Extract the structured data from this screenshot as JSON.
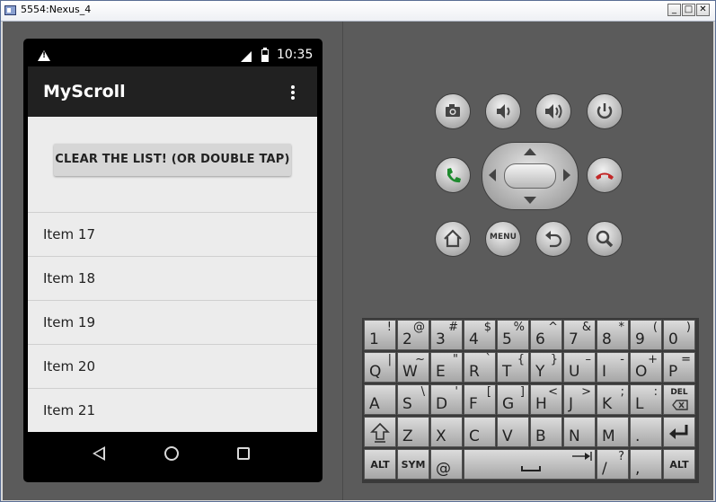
{
  "window": {
    "title": "5554:Nexus_4",
    "min_glyph": "_",
    "max_glyph": "□",
    "close_glyph": "✕"
  },
  "device": {
    "clock": "10:35",
    "app_title": "MyScroll",
    "clear_button": "CLEAR THE LIST! (OR DOUBLE TAP)",
    "list_items": [
      "Item 17",
      "Item 18",
      "Item 19",
      "Item 20",
      "Item 21"
    ]
  },
  "controls": {
    "menu_label": "MENU"
  },
  "keyboard": {
    "row1": [
      [
        "1",
        "!"
      ],
      [
        "2",
        "@"
      ],
      [
        "3",
        "#"
      ],
      [
        "4",
        "$"
      ],
      [
        "5",
        "%"
      ],
      [
        "6",
        "^"
      ],
      [
        "7",
        "&"
      ],
      [
        "8",
        "*"
      ],
      [
        "9",
        "("
      ],
      [
        "0",
        ")"
      ]
    ],
    "row2": [
      [
        "Q",
        "|"
      ],
      [
        "W",
        "~"
      ],
      [
        "E",
        "\""
      ],
      [
        "R",
        "`"
      ],
      [
        "T",
        "{"
      ],
      [
        "Y",
        "}"
      ],
      [
        "U",
        "–"
      ],
      [
        "I",
        "-"
      ],
      [
        "O",
        "+"
      ],
      [
        "P",
        "="
      ]
    ],
    "row3": [
      [
        "A",
        ""
      ],
      [
        "S",
        "\\"
      ],
      [
        "D",
        "'"
      ],
      [
        "F",
        "["
      ],
      [
        "G",
        "]"
      ],
      [
        "H",
        "<"
      ],
      [
        "J",
        ">"
      ],
      [
        "K",
        ";"
      ],
      [
        "L",
        ":"
      ]
    ],
    "row4": [
      [
        "Z",
        ""
      ],
      [
        "X",
        ""
      ],
      [
        "C",
        ""
      ],
      [
        "V",
        ""
      ],
      [
        "B",
        ""
      ],
      [
        "N",
        ""
      ],
      [
        "M",
        ""
      ],
      [
        ".",
        ""
      ]
    ],
    "del_label": "DEL",
    "alt_label": "ALT",
    "sym_label": "SYM",
    "at_key": "@",
    "slash_key": "/",
    "slash_alt": "?",
    "comma_key": ","
  }
}
